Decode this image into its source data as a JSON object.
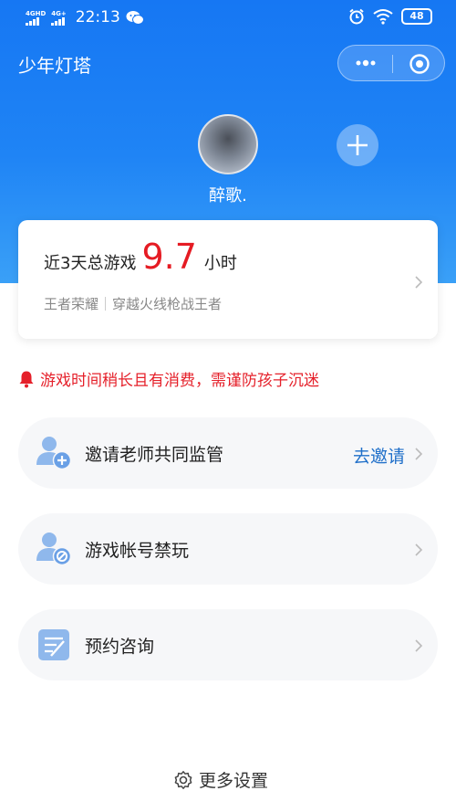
{
  "status_bar": {
    "signal1_label": "4GHD",
    "signal2_label": "4G+",
    "time": "22:13",
    "wechat_icon": "wechat-icon",
    "battery": "48"
  },
  "nav": {
    "title": "少年灯塔"
  },
  "profile": {
    "username": "醉歌."
  },
  "summary_card": {
    "prefix": "近3天总游戏",
    "hours": "9.7",
    "unit": "小时",
    "games": [
      "王者荣耀",
      "穿越火线枪战王者"
    ]
  },
  "warning": {
    "text": "游戏时间稍长且有消费，需谨防孩子沉迷"
  },
  "menu": {
    "invite_teacher": {
      "label": "邀请老师共同监管",
      "action": "去邀请"
    },
    "ban_account": {
      "label": "游戏帐号禁玩"
    },
    "consult": {
      "label": "预约咨询"
    }
  },
  "footer": {
    "label": "更多设置"
  },
  "colors": {
    "header_blue": "#1677f3",
    "accent_red": "#e51b23",
    "link_blue": "#1f6fc9"
  }
}
